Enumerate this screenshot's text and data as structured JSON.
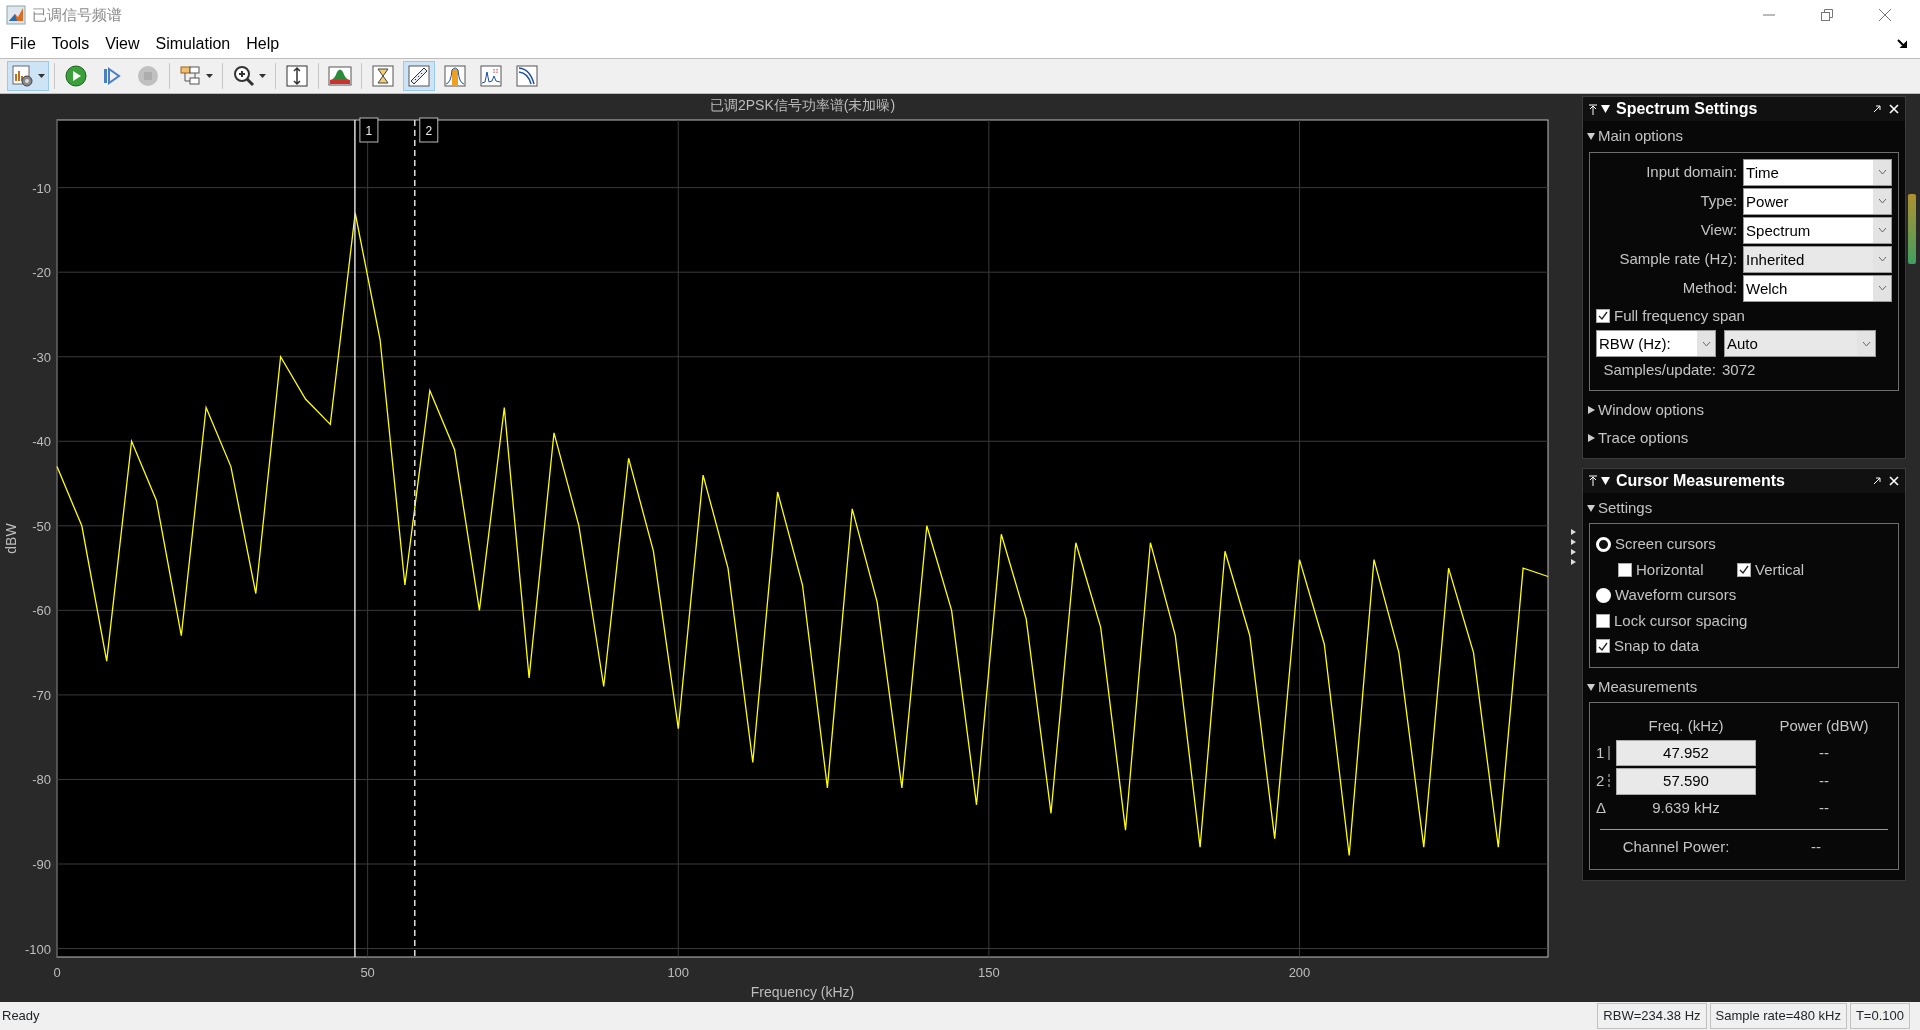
{
  "window": {
    "title": "已调信号频谱"
  },
  "menu": [
    {
      "label": "File"
    },
    {
      "label": "Tools"
    },
    {
      "label": "View"
    },
    {
      "label": "Simulation"
    },
    {
      "label": "Help"
    }
  ],
  "toolbar": [
    [
      {
        "kind": "settings",
        "pressed": true,
        "disabled": false,
        "dropdown": true
      }
    ],
    [
      {
        "kind": "run",
        "pressed": false,
        "disabled": false,
        "dropdown": false
      },
      {
        "kind": "step",
        "pressed": false,
        "disabled": false,
        "dropdown": false
      },
      {
        "kind": "stop",
        "pressed": false,
        "disabled": true,
        "dropdown": false
      }
    ],
    [
      {
        "kind": "highlight",
        "pressed": false,
        "disabled": false,
        "dropdown": true
      }
    ],
    [
      {
        "kind": "zoom",
        "pressed": false,
        "disabled": false,
        "dropdown": true
      }
    ],
    [
      {
        "kind": "scale",
        "pressed": false,
        "disabled": false,
        "dropdown": false
      }
    ],
    [
      {
        "kind": "spectrum_settings",
        "pressed": false,
        "disabled": false,
        "dropdown": false
      }
    ],
    [
      {
        "kind": "hourglass",
        "pressed": false,
        "disabled": false,
        "dropdown": false
      },
      {
        "kind": "ruler",
        "pressed": true,
        "disabled": false,
        "dropdown": false
      },
      {
        "kind": "peak",
        "pressed": false,
        "disabled": false,
        "dropdown": false
      },
      {
        "kind": "channel",
        "pressed": false,
        "disabled": false,
        "dropdown": false
      },
      {
        "kind": "curve",
        "pressed": false,
        "disabled": false,
        "dropdown": false
      }
    ]
  ],
  "plot": {
    "chart_data": {
      "type": "line",
      "title": "已调2PSK信号功率谱(未加噪)",
      "xlabel": "Frequency (kHz)",
      "ylabel": "dBW",
      "xlim": [
        0,
        240
      ],
      "ylim": [
        -101,
        -2
      ],
      "xticks": [
        0,
        50,
        100,
        150,
        200
      ],
      "yticks": [
        -100,
        -90,
        -80,
        -70,
        -60,
        -50,
        -40,
        -30,
        -20,
        -10
      ],
      "x": [
        0,
        4,
        8,
        12,
        16,
        20,
        24,
        28,
        32,
        36,
        40,
        44,
        48,
        52,
        56,
        60,
        64,
        68,
        72,
        76,
        80,
        84,
        88,
        92,
        96,
        100,
        104,
        108,
        112,
        116,
        120,
        124,
        128,
        132,
        136,
        140,
        144,
        148,
        152,
        156,
        160,
        164,
        168,
        172,
        176,
        180,
        184,
        188,
        192,
        196,
        200,
        204,
        208,
        212,
        216,
        220,
        224,
        228,
        232,
        236,
        240
      ],
      "grid": true,
      "ref_lines": [
        {
          "axis": "x",
          "value": 47.952
        },
        {
          "axis": "x",
          "value": 57.59
        }
      ],
      "series": [
        {
          "color": "#ffff00",
          "values": [
            -43,
            -50,
            -66,
            -40,
            -47,
            -63,
            -36,
            -43,
            -58,
            -30,
            -35,
            -38,
            -13,
            -28,
            -57,
            -34,
            -41,
            -60,
            -36,
            -68,
            -39,
            -50,
            -69,
            -42,
            -53,
            -74,
            -44,
            -55,
            -78,
            -46,
            -57,
            -81,
            -48,
            -59,
            -81,
            -50,
            -60,
            -83,
            -51,
            -61,
            -84,
            -52,
            -62,
            -86,
            -52,
            -63,
            -88,
            -53,
            -63,
            -87,
            -54,
            -64,
            -89,
            -54,
            -65,
            -88,
            -55,
            -65,
            -88,
            -55,
            -56
          ]
        }
      ]
    },
    "cursor_tags": [
      {
        "label": "1"
      },
      {
        "label": "2"
      }
    ]
  },
  "spectrum_settings": {
    "title": "Spectrum Settings",
    "main_options": {
      "label": "Main options",
      "expanded": true,
      "fields": [
        {
          "label": "Input domain:",
          "value": "Time",
          "kind": "select"
        },
        {
          "label": "Type:",
          "value": "Power",
          "kind": "select"
        },
        {
          "label": "View:",
          "value": "Spectrum",
          "kind": "select"
        },
        {
          "label": "Sample rate (Hz):",
          "value": "Inherited",
          "kind": "combo"
        },
        {
          "label": "Method:",
          "value": "Welch",
          "kind": "select"
        }
      ],
      "full_span": {
        "label": "Full frequency span",
        "checked": true
      },
      "rbw": {
        "selector": "RBW (Hz):",
        "value": "Auto"
      },
      "samples": {
        "label": "Samples/update:",
        "value": "3072"
      }
    },
    "sections": [
      {
        "label": "Window options",
        "expanded": false
      },
      {
        "label": "Trace options",
        "expanded": false
      }
    ]
  },
  "cursor_measurements": {
    "title": "Cursor Measurements",
    "settings": {
      "label": "Settings",
      "expanded": true,
      "items": [
        {
          "kind": "radio",
          "label": "Screen cursors",
          "selected": true
        },
        {
          "kind": "pair",
          "items": [
            {
              "label": "Horizontal",
              "checked": false
            },
            {
              "label": "Vertical",
              "checked": true
            }
          ]
        },
        {
          "kind": "radio",
          "label": "Waveform cursors",
          "selected": false
        },
        {
          "kind": "checkbox",
          "label": "Lock cursor spacing",
          "checked": false
        },
        {
          "kind": "checkbox",
          "label": "Snap to data",
          "checked": true
        }
      ]
    },
    "measurements": {
      "label": "Measurements",
      "expanded": true,
      "headers": [
        "Freq. (kHz)",
        "Power (dBW)"
      ],
      "rows": [
        {
          "label": "1",
          "freq": "47.952",
          "power": "--"
        },
        {
          "label": "2",
          "freq": "57.590",
          "power": "--"
        }
      ],
      "delta": {
        "label": "Δ",
        "freq": "9.639 kHz",
        "power": "--"
      },
      "channel_power": {
        "label": "Channel Power:",
        "value": "--"
      }
    }
  },
  "status_bar": {
    "message": "Ready",
    "fields": [
      "RBW=234.38 Hz",
      "Sample rate=480 kHz",
      "T=0.100"
    ]
  }
}
